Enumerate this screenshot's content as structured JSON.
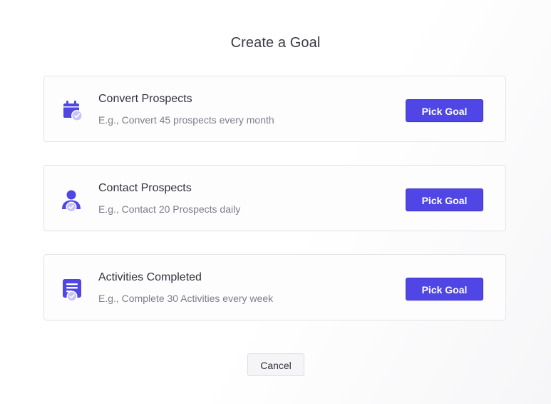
{
  "dialog": {
    "title": "Create a Goal",
    "cancel_label": "Cancel"
  },
  "goals": [
    {
      "title": "Convert Prospects",
      "description": "E.g., Convert 45 prospects every month",
      "button_label": "Pick Goal",
      "icon": "calendar-check-icon"
    },
    {
      "title": "Contact Prospects",
      "description": "E.g., Contact 20 Prospects daily",
      "button_label": "Pick Goal",
      "icon": "user-check-icon"
    },
    {
      "title": "Activities Completed",
      "description": "E.g., Complete 30 Activities every week",
      "button_label": "Pick Goal",
      "icon": "task-check-icon"
    }
  ],
  "colors": {
    "accent": "#4f46e5",
    "icon_badge": "#c7c4f5",
    "card_border": "#e4e4ea"
  }
}
